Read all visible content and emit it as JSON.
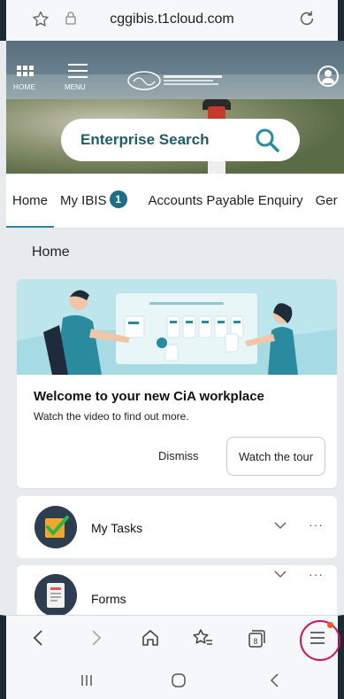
{
  "browser": {
    "url": "cggibis.t1cloud.com",
    "icons": [
      "star-outline-icon",
      "lock-icon",
      "reload-icon"
    ]
  },
  "header": {
    "home_label": "HOME",
    "menu_label": "MENU",
    "search_label": "Enterprise Search",
    "icons": [
      "app-grid-icon",
      "hamburger-menu-icon",
      "organization-logo",
      "user-avatar-icon",
      "search-icon"
    ]
  },
  "tabs": [
    {
      "label": "Home",
      "active": true
    },
    {
      "label": "My IBIS",
      "badge": "1"
    },
    {
      "label": "Accounts Payable Enquiry"
    },
    {
      "label": "Ger"
    }
  ],
  "page": {
    "title": "Home"
  },
  "welcome_card": {
    "title": "Welcome to your new CiA workplace",
    "subtitle": "Watch the video to find out more.",
    "dismiss_label": "Dismiss",
    "tour_label": "Watch the tour"
  },
  "list_cards": [
    {
      "label": "My Tasks",
      "icon": "tasks-checkbox-icon"
    },
    {
      "label": "Forms",
      "icon": "forms-document-icon"
    }
  ],
  "toolbar": {
    "icons": [
      "back-icon",
      "forward-icon",
      "home-icon",
      "bookmarks-icon",
      "tabs-icon",
      "browser-menu-icon"
    ],
    "tab_count": "8"
  },
  "colors": {
    "accent": "#1f6e83",
    "teal_text": "#1f5d6b",
    "highlight": "#d1125c",
    "notify": "#f0552c",
    "illustration_bg": "#bde6ec"
  }
}
